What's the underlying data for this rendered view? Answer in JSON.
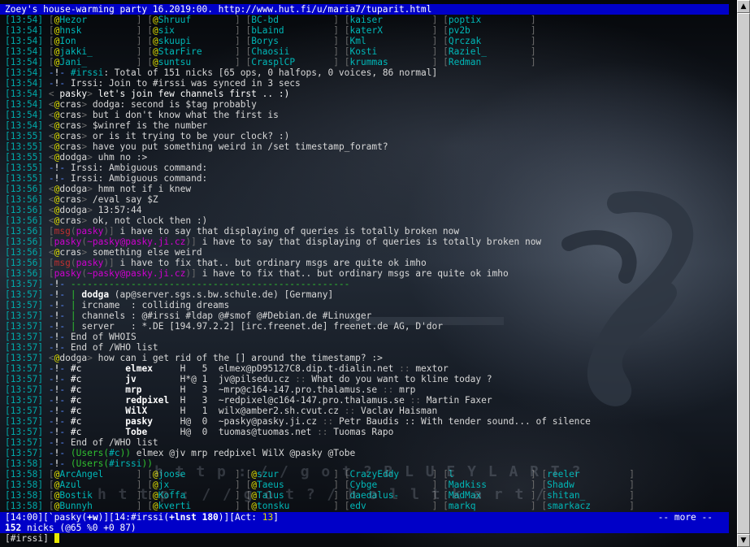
{
  "title": "Zoey's house-warming party 16.2019:00. http://www.hut.fi/u/maria7/tuparit.html",
  "names_rows": [
    {
      "ts": "[13:54]",
      "cells": [
        "@Hezor",
        "@Shruuf",
        "BC-bd",
        "kaiser",
        "poptix"
      ]
    },
    {
      "ts": "[13:54]",
      "cells": [
        "@hnsk",
        "@six",
        "bLaind",
        "katerX",
        "pv2b"
      ]
    },
    {
      "ts": "[13:54]",
      "cells": [
        "@Ion",
        "@skuupi",
        "Borys",
        "Kml",
        "Qrczak"
      ]
    },
    {
      "ts": "[13:54]",
      "cells": [
        "@jakki_",
        "@StarFire",
        "Chaosii",
        "Kosti",
        "Raziel_"
      ]
    },
    {
      "ts": "[13:54]",
      "cells": [
        "@Jani_",
        "@suntsu",
        "CrasplCP",
        "krummas",
        "Redman"
      ]
    }
  ],
  "messages_a": [
    {
      "ts": "[13:54]",
      "type": "info",
      "text": "#irssi: Total of 151 nicks [65 ops, 0 halfops, 0 voices, 86 normal]"
    },
    {
      "ts": "[13:54]",
      "type": "info",
      "text": "Irssi: Join to #irssi was synced in 3 secs"
    },
    {
      "ts": "[13:54]",
      "type": "own",
      "nick": " pasky",
      "text": " let's join few channels first .. :)"
    },
    {
      "ts": "[13:54]",
      "type": "msg",
      "nick": "cras",
      "text": " dodga: second is $tag probably"
    },
    {
      "ts": "[13:54]",
      "type": "msg",
      "nick": "cras",
      "text": " but i don't know what the first is"
    },
    {
      "ts": "[13:54]",
      "type": "msg",
      "nick": "cras",
      "text": " $winref is the number"
    },
    {
      "ts": "[13:55]",
      "type": "msg",
      "nick": "cras",
      "text": " or is it trying to be your clock? :)"
    },
    {
      "ts": "[13:55]",
      "type": "msg",
      "nick": "cras",
      "text": " have you put something weird in /set timestamp_foramt?"
    },
    {
      "ts": "[13:55]",
      "type": "msg",
      "nick": "dodga",
      "text": " uhm no :>"
    },
    {
      "ts": "[13:55]",
      "type": "info",
      "text": "Irssi: Ambiguous command:"
    },
    {
      "ts": "[13:55]",
      "type": "info",
      "text": "Irssi: Ambiguous command:"
    },
    {
      "ts": "[13:56]",
      "type": "msg",
      "nick": "dodga",
      "text": " hmm not if i knew"
    },
    {
      "ts": "[13:56]",
      "type": "msg",
      "nick": "cras",
      "text": " /eval say $Z"
    },
    {
      "ts": "[13:56]",
      "type": "msg",
      "nick": "dodga",
      "text": " 13:57:44"
    },
    {
      "ts": "[13:56]",
      "type": "msg",
      "nick": "cras",
      "text": " ok, not clock then :)"
    },
    {
      "ts": "[13:56]",
      "type": "msgout",
      "target": "pasky",
      "text": " i have to say that displaying of queries is totally broken now"
    },
    {
      "ts": "[13:56]",
      "type": "querymsg",
      "nick": "pasky",
      "host": "~pasky@pasky.ji.cz",
      "text": " i have to say that displaying of queries is totally broken now"
    },
    {
      "ts": "[13:56]",
      "type": "msg",
      "nick": "cras",
      "text": " something else weird"
    },
    {
      "ts": "[13:56]",
      "type": "msgout",
      "target": "pasky",
      "text": " i have to fix that.. but ordinary msgs are quite ok imho"
    },
    {
      "ts": "[13:56]",
      "type": "querymsg",
      "nick": "pasky",
      "host": "~pasky@pasky.ji.cz",
      "text": " i have to fix that.. but ordinary msgs are quite ok imho"
    }
  ],
  "whois": {
    "ts": "[13:57]",
    "separator": "---------------------------------------------------",
    "nick": "dodga",
    "host": "ap@server.sgs.s.bw.schule.de",
    "country": "Germany",
    "ircname_label": "ircname  ",
    "ircname": "colliding dreams",
    "channels_label": "channels ",
    "channels": "@#irssi #ldap @#smof @#Debian.de #Linuxger",
    "server_label": "server   ",
    "server": "*.DE",
    "server_ip": "[194.97.2.2]",
    "server_name": "[irc.freenet.de]",
    "server_desc": "freenet.de AG, D'dor",
    "end_whois": "End of WHOIS",
    "end_who": "End of /WHO list"
  },
  "question": {
    "ts": "[13:57]",
    "nick": "dodga",
    "text": " how can i get rid of the [] around the timestamp? :>"
  },
  "who_rows": [
    {
      "ts": "[13:57]",
      "chan": "#c",
      "nick": "elmex",
      "flags": "H   5",
      "host": "elmex@pD95127C8.dip.t-dialin.net",
      "name": "mextor"
    },
    {
      "ts": "[13:57]",
      "chan": "#c",
      "nick": "jv",
      "flags": "H*@ 1",
      "host": "jv@pilsedu.cz",
      "name": "What do you want to kline today ?"
    },
    {
      "ts": "[13:57]",
      "chan": "#c",
      "nick": "mrp",
      "flags": "H   3",
      "host": "~mrp@c164-147.pro.thalamus.se",
      "name": "mrp"
    },
    {
      "ts": "[13:57]",
      "chan": "#c",
      "nick": "redpixel",
      "flags": "H   3",
      "host": "~redpixel@c164-147.pro.thalamus.se",
      "name": "Martin Faxer"
    },
    {
      "ts": "[13:57]",
      "chan": "#c",
      "nick": "WilX",
      "flags": "H   1",
      "host": "wilx@amber2.sh.cvut.cz",
      "name": "Vaclav Haisman"
    },
    {
      "ts": "[13:57]",
      "chan": "#c",
      "nick": "pasky",
      "flags": "H@  0",
      "host": "~pasky@pasky.ji.cz",
      "name": "Petr Baudis :: With tender sound... of silence"
    },
    {
      "ts": "[13:57]",
      "chan": "#c",
      "nick": "Tobe",
      "flags": "H@  0",
      "host": "tuomas@tuomas.net",
      "name": "Tuomas Rapo"
    }
  ],
  "end_who2": {
    "ts": "[13:57]",
    "text": "End of /WHO list"
  },
  "users_c": {
    "ts": "[13:57]",
    "label": "Users",
    "chan": "#c",
    "nicks": "elmex @jv mrp redpixel WilX @pasky @Tobe"
  },
  "users_irssi": {
    "ts": "[13:58]",
    "label": "Users",
    "chan": "#irssi"
  },
  "names_rows2": [
    {
      "ts": "[13:58]",
      "cells": [
        "@ArcAngel",
        "@joose",
        "@szur",
        "CrazyEddy",
        "l",
        "reeler"
      ]
    },
    {
      "ts": "[13:58]",
      "cells": [
        "@Azul",
        "@jx_",
        "@Taeus",
        "Cybge",
        "Madkiss",
        "Shadw"
      ]
    },
    {
      "ts": "[13:58]",
      "cells": [
        "@Bostik",
        "@Koffa",
        "@Talus",
        "daedalus-",
        "MadMax",
        "shitan_"
      ]
    },
    {
      "ts": "[13:58]",
      "cells": [
        "@Bunnyh",
        "@kverti",
        "@tonsku",
        "edv",
        "markq",
        "smarkacz"
      ]
    }
  ],
  "status1": {
    "time": "14:00",
    "nick": "`pasky",
    "umode": "+w",
    "window": "14:#irssi",
    "chanmode": "+lnst 180",
    "act_label": "Act: ",
    "act": "13",
    "more": "-- more --"
  },
  "status2": {
    "count": "152",
    "text": " nicks (@65 %0 +0 87)"
  },
  "input": {
    "prompt": "[#irssi] "
  },
  "watermark": {
    "row1": "h t t p : / / g o t ? B L U E Y L A R T ?",
    "row2": "h t t p : / / g o t ? / h o l l t k a r t /"
  },
  "colors": {
    "statusbar": "#0000c8",
    "timestamp": "#00a8a8",
    "op": "#e0e000"
  },
  "icons": {
    "up": "arrow-up-icon",
    "down": "arrow-down-icon"
  }
}
